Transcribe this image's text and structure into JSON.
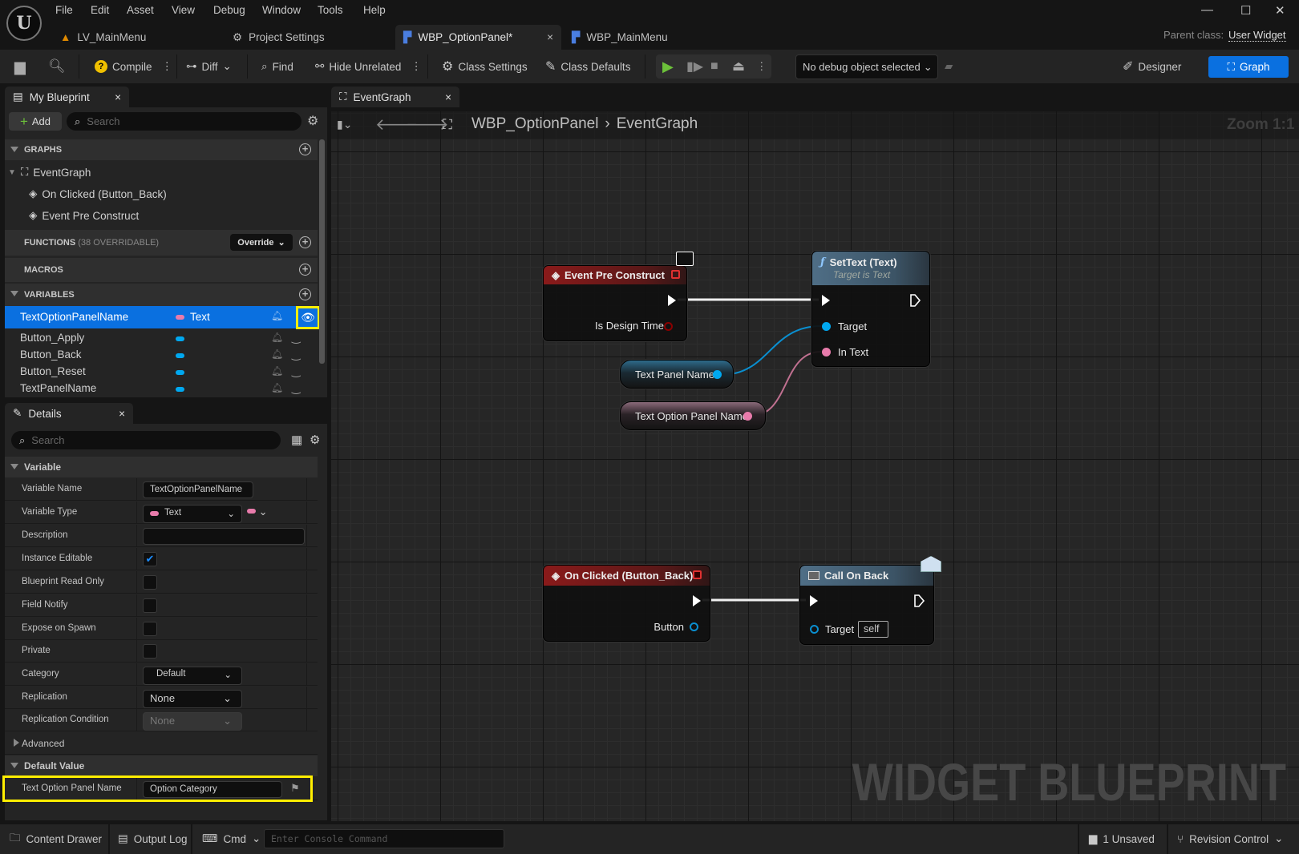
{
  "menu": [
    "File",
    "Edit",
    "Asset",
    "View",
    "Debug",
    "Window",
    "Tools",
    "Help"
  ],
  "doc_tabs": [
    {
      "label": "LV_MainMenu",
      "icon": "level-icon"
    },
    {
      "label": "Project Settings",
      "icon": "settings-icon"
    },
    {
      "label": "WBP_OptionPanel*",
      "icon": "widget-blueprint-icon",
      "active": true,
      "close": "×"
    },
    {
      "label": "WBP_MainMenu",
      "icon": "widget-blueprint-icon"
    }
  ],
  "parent_class": {
    "label": "Parent class:",
    "value": "User Widget"
  },
  "window_controls": {
    "minimize": "—",
    "maximize": "☐",
    "close": "✕"
  },
  "toolbar": {
    "compile": "Compile",
    "diff": "Diff",
    "find": "Find",
    "hide_unrelated": "Hide Unrelated",
    "class_settings": "Class Settings",
    "class_defaults": "Class Defaults",
    "debug_object": "No debug object selected",
    "designer": "Designer",
    "graph": "Graph"
  },
  "my_blueprint": {
    "tab": "My Blueprint",
    "close": "×",
    "add": "Add",
    "search_placeholder": "Search",
    "graphs_header": "GRAPHS",
    "graphs": {
      "root": "EventGraph",
      "events": [
        "On Clicked (Button_Back)",
        "Event Pre Construct"
      ]
    },
    "functions_header": "FUNCTIONS",
    "functions_note": "(38 OVERRIDABLE)",
    "override": "Override",
    "macros_header": "MACROS",
    "variables_header": "VARIABLES",
    "variables": [
      {
        "name": "TextOptionPanelName",
        "type": "Text",
        "color": "#e87bab",
        "selected": true
      },
      {
        "name": "Button_Apply",
        "color": "#00a8f0"
      },
      {
        "name": "Button_Back",
        "color": "#00a8f0"
      },
      {
        "name": "Button_Reset",
        "color": "#00a8f0"
      },
      {
        "name": "TextPanelName",
        "color": "#00a8f0"
      }
    ]
  },
  "details": {
    "tab": "Details",
    "close": "×",
    "search_placeholder": "Search",
    "section_variable": "Variable",
    "variable_name": {
      "label": "Variable Name",
      "value": "TextOptionPanelName"
    },
    "variable_type": {
      "label": "Variable Type",
      "value": "Text"
    },
    "description": {
      "label": "Description",
      "value": ""
    },
    "instance_editable": {
      "label": "Instance Editable",
      "checked": true,
      "mark": "✔"
    },
    "blueprint_read_only": {
      "label": "Blueprint Read Only",
      "checked": false
    },
    "field_notify": {
      "label": "Field Notify",
      "checked": false
    },
    "expose_on_spawn": {
      "label": "Expose on Spawn",
      "checked": false
    },
    "private": {
      "label": "Private",
      "checked": false
    },
    "category": {
      "label": "Category",
      "value": "Default"
    },
    "replication": {
      "label": "Replication",
      "value": "None"
    },
    "replication_condition": {
      "label": "Replication Condition",
      "value": "None"
    },
    "advanced": "Advanced",
    "section_default": "Default Value",
    "default_value": {
      "label": "Text Option Panel Name",
      "value": "Option Category"
    }
  },
  "graph": {
    "tab": "EventGraph",
    "close": "×",
    "breadcrumb": {
      "blueprint": "WBP_OptionPanel",
      "sep": "›",
      "graph": "EventGraph"
    },
    "zoom": "Zoom 1:1",
    "watermark": "WIDGET BLUEPRINT",
    "nodes": {
      "pre_construct": {
        "title": "Event Pre Construct",
        "pin": "Is Design Time"
      },
      "settext": {
        "title": "SetText (Text)",
        "subtitle": "Target is Text",
        "pins": [
          "Target",
          "In Text"
        ]
      },
      "text_panel_name": {
        "label": "Text Panel Name"
      },
      "text_option_panel_name": {
        "label": "Text Option Panel Name"
      },
      "on_clicked": {
        "title": "On Clicked (Button_Back)",
        "pin": "Button"
      },
      "call_on_back": {
        "title": "Call On Back",
        "pin": "Target",
        "default": "self"
      }
    },
    "colors": {
      "object_pin": "#00a8f0",
      "text_pin": "#e87bab",
      "event_header": "#8a1a1a",
      "function_header": "#4f6e86"
    }
  },
  "status_bar": {
    "content_drawer": "Content Drawer",
    "output_log": "Output Log",
    "cmd": "Cmd",
    "console_placeholder": "Enter Console Command",
    "unsaved": "1 Unsaved",
    "revision_control": "Revision Control"
  },
  "highlight_color": "#ffee00",
  "accent": "#0a70e0"
}
